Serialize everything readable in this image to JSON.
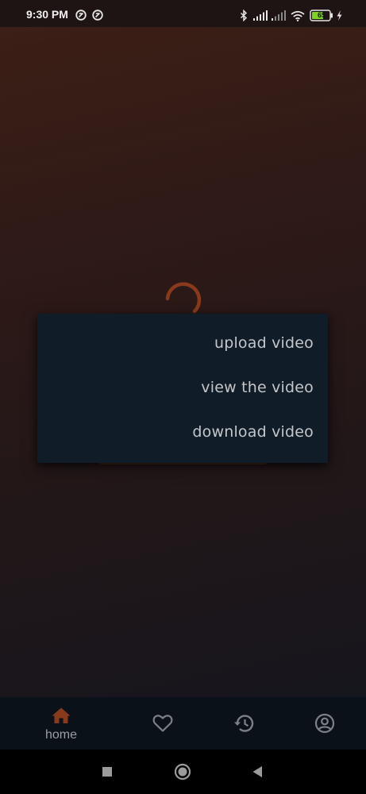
{
  "status_bar": {
    "time": "9:30 PM",
    "battery_level": "65",
    "icons": [
      "notification-icon",
      "notification-icon",
      "bluetooth-icon",
      "signal-icon",
      "signal-icon",
      "wifi-icon",
      "battery-icon",
      "charging-icon"
    ]
  },
  "colors": {
    "accent": "#8a3a1c",
    "menu_background": "#101d28",
    "menu_text": "#c4c6c9",
    "nav_background": "#0b1119"
  },
  "popup_menu": {
    "items": [
      {
        "label": "upload video"
      },
      {
        "label": "view the video"
      },
      {
        "label": "download video"
      }
    ]
  },
  "bottom_nav": {
    "items": [
      {
        "icon": "home-icon",
        "label": "home",
        "active": true
      },
      {
        "icon": "heart-icon",
        "label": "",
        "active": false
      },
      {
        "icon": "history-icon",
        "label": "",
        "active": false
      },
      {
        "icon": "account-icon",
        "label": "",
        "active": false
      }
    ]
  },
  "system_nav": {
    "buttons": [
      "recents-button",
      "home-button",
      "back-button"
    ]
  }
}
